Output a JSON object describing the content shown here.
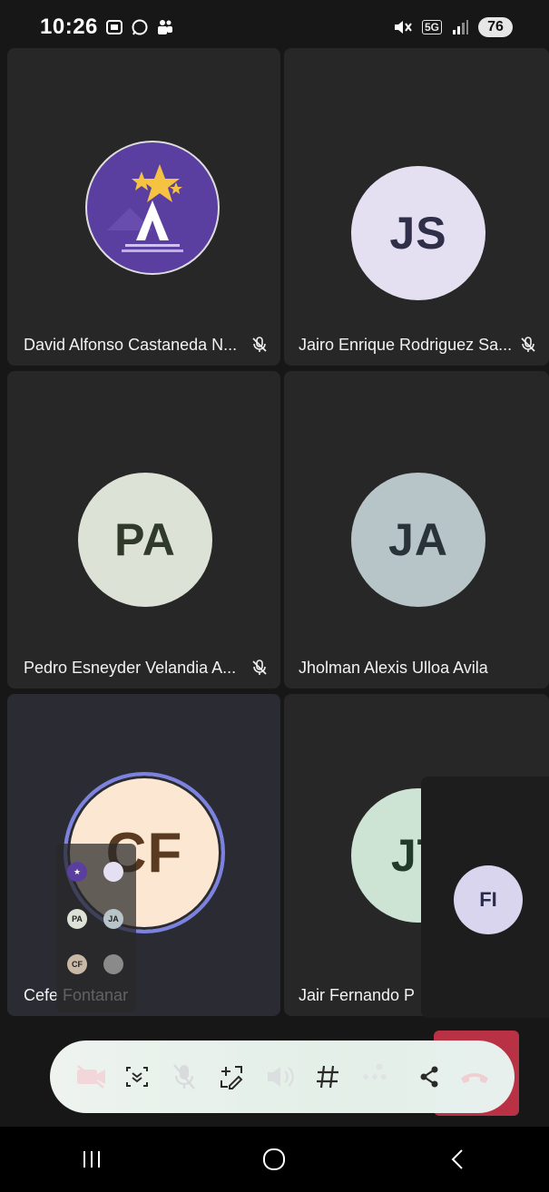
{
  "status_bar": {
    "time": "10:26",
    "battery": "76",
    "network": "5G",
    "icons": [
      "screen-record-icon",
      "whatsapp-icon",
      "teams-icon",
      "mute-icon",
      "signal-icon"
    ]
  },
  "participants": [
    {
      "name": "David Alfonso Castaneda N...",
      "muted": true,
      "avatar_type": "logo"
    },
    {
      "name": "Jairo Enrique Rodriguez Sa...",
      "muted": true,
      "initials": "JS",
      "avatar_bg": "#e4e0f2",
      "avatar_fg": "#2f2f4a"
    },
    {
      "name": "Pedro Esneyder Velandia A...",
      "muted": true,
      "initials": "PA",
      "avatar_bg": "#dde2d6",
      "avatar_fg": "#2f3a2a"
    },
    {
      "name": "Jholman Alexis Ulloa Avila",
      "muted": false,
      "initials": "JA",
      "avatar_bg": "#b7c4c8",
      "avatar_fg": "#283238"
    },
    {
      "name": "Cefe Fontanar",
      "muted": false,
      "initials": "CF",
      "avatar_bg": "#fbe7d2",
      "avatar_fg": "#5a3a20",
      "speaking": true
    },
    {
      "name": "Jair Fernando P",
      "muted": false,
      "initials": "JT",
      "avatar_bg": "#cde3d3",
      "avatar_fg": "#223a2a"
    }
  ],
  "self_view": {
    "initials": "FI"
  },
  "thumbnail_initials": [
    "PA",
    "JA",
    "CF"
  ],
  "controls": [
    "camera-off-icon",
    "share-screen-icon",
    "mic-off-icon",
    "whiteboard-icon",
    "speaker-icon",
    "hashtag-icon",
    "more-icon",
    "share-icon",
    "hang-up-icon"
  ],
  "colors": {
    "background": "#171717",
    "tile": "#272727",
    "hang_up": "#c8344a",
    "speaking_ring": "#7c82e0"
  }
}
